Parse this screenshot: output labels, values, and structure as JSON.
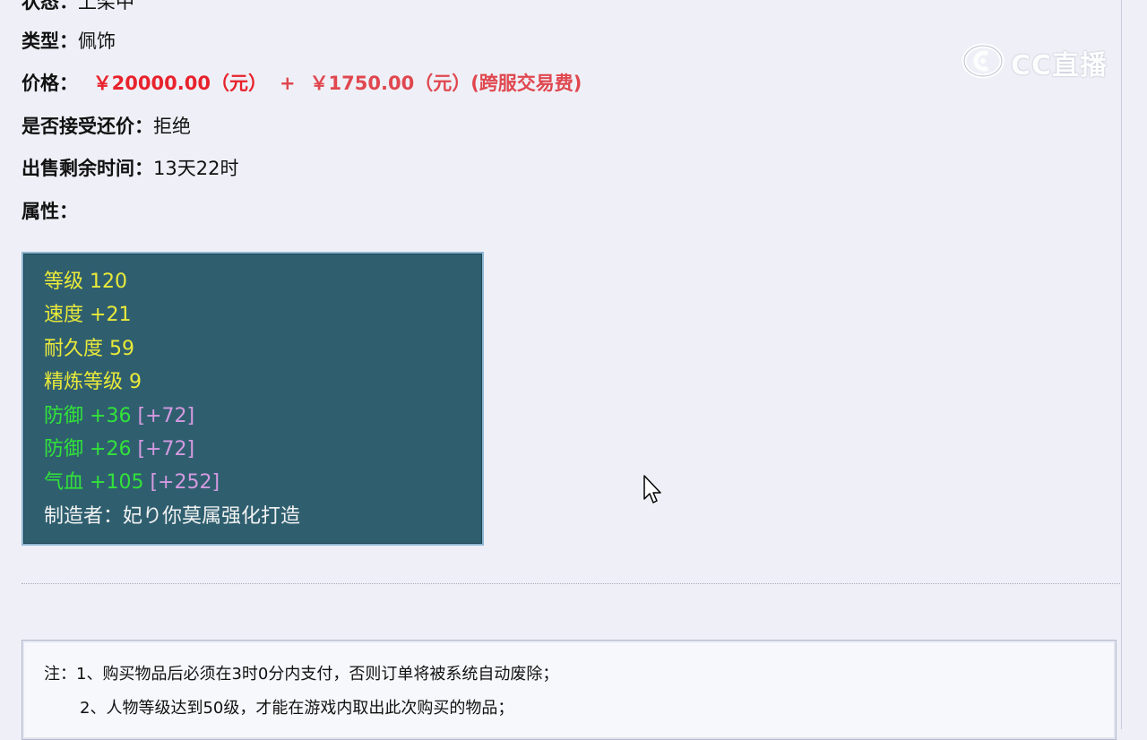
{
  "item": {
    "status": {
      "label": "状态：",
      "value": "上架中"
    },
    "type": {
      "label": "类型：",
      "value": "佩饰"
    },
    "price": {
      "label": "价格：",
      "amount": "￥20000.00（元）",
      "plus": "+",
      "fee": "￥1750.00（元）(跨服交易费)"
    },
    "bargain": {
      "label": "是否接受还价：",
      "value": "拒绝"
    },
    "time_left": {
      "label": "出售剩余时间：",
      "value": "13天22时"
    },
    "attributes_label": "属性："
  },
  "attributes": {
    "level": {
      "name": "等级",
      "value": "120"
    },
    "speed": {
      "name": "速度",
      "value": "+21"
    },
    "durability": {
      "name": "耐久度",
      "value": "59"
    },
    "refine": {
      "name": "精炼等级",
      "value": "9"
    },
    "defense1": {
      "name": "防御",
      "value": "+36",
      "bonus": "[+72]"
    },
    "defense2": {
      "name": "防御",
      "value": "+26",
      "bonus": "[+72]"
    },
    "hp": {
      "name": "气血",
      "value": "+105",
      "bonus": "[+252]"
    },
    "maker": {
      "label": "制造者：",
      "value": "妃り你莫属强化打造"
    }
  },
  "notes": {
    "line1": "注：1、购买物品后必须在3时0分内支付，否则订单将被系统自动废除；",
    "line2": "2、人物等级达到50级，才能在游戏内取出此次购买的物品；"
  },
  "watermark": {
    "text": "CC直播"
  },
  "colors": {
    "price_red": "#e8222c",
    "attr_bg": "#2f5f6f",
    "attr_yellow": "#eaea3a",
    "attr_green": "#32e23a",
    "attr_purple": "#d49ae0"
  },
  "icons": {
    "watermark": "cc-live-logo-icon",
    "cursor": "mouse-pointer-icon"
  }
}
